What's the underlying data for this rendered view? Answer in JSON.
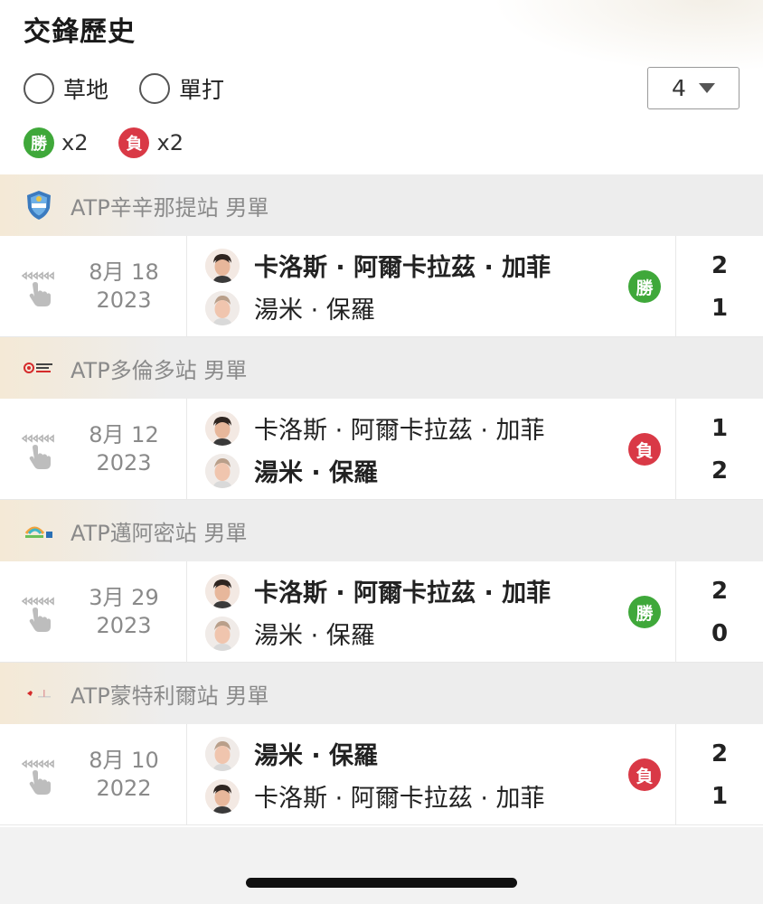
{
  "header": {
    "title": "交鋒歷史"
  },
  "filters": {
    "surface_label": "草地",
    "type_label": "單打",
    "select_value": "4"
  },
  "summary": {
    "win_badge": "勝",
    "win_count": "x2",
    "loss_badge": "負",
    "loss_count": "x2"
  },
  "groups": [
    {
      "tournament": "ATP辛辛那提站 男單",
      "logo": "cincinnati-open-logo",
      "match": {
        "date_line1": "8月 18",
        "date_line2": "2023",
        "players": [
          {
            "name": "卡洛斯 · 阿爾卡拉茲 · 加菲",
            "bold": true,
            "score": "2"
          },
          {
            "name": "湯米 · 保羅",
            "bold": false,
            "score": "1"
          }
        ],
        "result": "勝",
        "result_type": "win"
      }
    },
    {
      "tournament": "ATP多倫多站 男單",
      "logo": "national-bank-open-logo",
      "match": {
        "date_line1": "8月 12",
        "date_line2": "2023",
        "players": [
          {
            "name": "卡洛斯 · 阿爾卡拉茲 · 加菲",
            "bold": false,
            "score": "1"
          },
          {
            "name": "湯米 · 保羅",
            "bold": true,
            "score": "2"
          }
        ],
        "result": "負",
        "result_type": "loss"
      }
    },
    {
      "tournament": "ATP邁阿密站 男單",
      "logo": "miami-open-logo",
      "match": {
        "date_line1": "3月 29",
        "date_line2": "2023",
        "players": [
          {
            "name": "卡洛斯 · 阿爾卡拉茲 · 加菲",
            "bold": true,
            "score": "2"
          },
          {
            "name": "湯米 · 保羅",
            "bold": false,
            "score": "0"
          }
        ],
        "result": "勝",
        "result_type": "win"
      }
    },
    {
      "tournament": "ATP蒙特利爾站 男單",
      "logo": "montreal-open-logo",
      "match": {
        "date_line1": "8月 10",
        "date_line2": "2022",
        "players": [
          {
            "name": "湯米 · 保羅",
            "bold": true,
            "score": "2"
          },
          {
            "name": "卡洛斯 · 阿爾卡拉茲 · 加菲",
            "bold": false,
            "score": "1"
          }
        ],
        "result": "負",
        "result_type": "loss"
      }
    }
  ],
  "colors": {
    "win": "#3fa83a",
    "loss": "#d93946",
    "muted_text": "#8a8a8a",
    "header_bg": "#ededed"
  }
}
